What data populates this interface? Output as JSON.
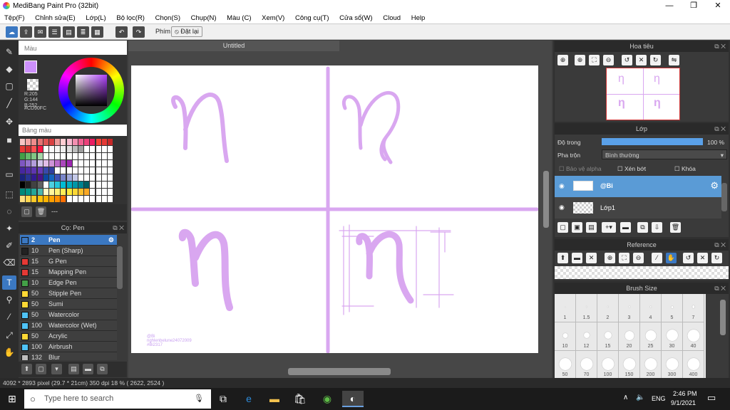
{
  "window": {
    "title": "MediBang Paint Pro (32bit)",
    "minimize": "—",
    "restore": "❐",
    "close": "✕"
  },
  "menu": [
    "Tệp(F)",
    "Chỉnh sửa(E)",
    "Lớp(L)",
    "Bộ lọc(R)",
    "Chọn(S)",
    "Chụp(N)",
    "Màu (C)",
    "Xem(V)",
    "Công cụ(T)",
    "Cửa sổ(W)",
    "Cloud",
    "Help"
  ],
  "toolbar": {
    "key_label": "Phím",
    "reset_label": "Đặt lại"
  },
  "document": {
    "tab": "Untitled",
    "watermark_name": "@Bi",
    "watermark_line2": "nghlenbelune24072009",
    "watermark_line3": "#Bi2317"
  },
  "color": {
    "header": "Màu",
    "r_label": "R:205",
    "g_label": "G:144",
    "b_label": "B:252",
    "hex": "#CD90FC",
    "current": "#cd90fc"
  },
  "palette": {
    "header": "Bảng màu",
    "footer": "---"
  },
  "brush": {
    "header": "Cọ: Pen",
    "items": [
      {
        "size": "2",
        "name": "Pen",
        "color": "#3b78c2",
        "selected": true
      },
      {
        "size": "10",
        "name": "Pen (Sharp)",
        "color": "#222222"
      },
      {
        "size": "15",
        "name": "G Pen",
        "color": "#e53935"
      },
      {
        "size": "15",
        "name": "Mapping Pen",
        "color": "#e53935"
      },
      {
        "size": "10",
        "name": "Edge Pen",
        "color": "#43a047"
      },
      {
        "size": "50",
        "name": "Stipple Pen",
        "color": "#fdd835"
      },
      {
        "size": "50",
        "name": "Sumi",
        "color": "#fdd835"
      },
      {
        "size": "50",
        "name": "Watercolor",
        "color": "#4fc3f7"
      },
      {
        "size": "100",
        "name": "Watercolor (Wet)",
        "color": "#4fc3f7"
      },
      {
        "size": "50",
        "name": "Acrylic",
        "color": "#fdd835"
      },
      {
        "size": "100",
        "name": "Airbrush",
        "color": "#4fc3f7"
      },
      {
        "size": "132",
        "name": "Blur",
        "color": "#bdbdbd"
      }
    ]
  },
  "navigator": {
    "header": "Hoa tiêu"
  },
  "layer": {
    "header": "Lớp",
    "opacity_label": "Độ trong",
    "opacity_value": "100 %",
    "opacity": 1.0,
    "blend_label": "Pha trộn",
    "blend_value": "Bình thường",
    "protect_alpha": "Bảo vệ alpha",
    "clip": "Xén bớt",
    "lock": "Khóa",
    "layers": [
      {
        "name": "@Bi",
        "selected": true
      },
      {
        "name": "Lớp1",
        "selected": false
      }
    ]
  },
  "reference": {
    "header": "Reference"
  },
  "brush_size": {
    "header": "Brush Size",
    "sizes": [
      "1",
      "1.5",
      "2",
      "3",
      "4",
      "5",
      "7",
      "10",
      "12",
      "15",
      "20",
      "25",
      "30",
      "40",
      "50",
      "70",
      "100",
      "150",
      "200",
      "300",
      "400"
    ]
  },
  "status": {
    "text": "4092 * 2893 pixel  (29.7 * 21cm)  350 dpi  18 %  ( 2622, 2524 )"
  },
  "taskbar": {
    "search_placeholder": "Type here to search",
    "lang": "ENG",
    "time": "2:46 PM",
    "date": "9/1/2021"
  },
  "colors": {
    "accent": "#3b78c2",
    "ink": "#d9a7f0",
    "dark": "#3a3a3a"
  }
}
